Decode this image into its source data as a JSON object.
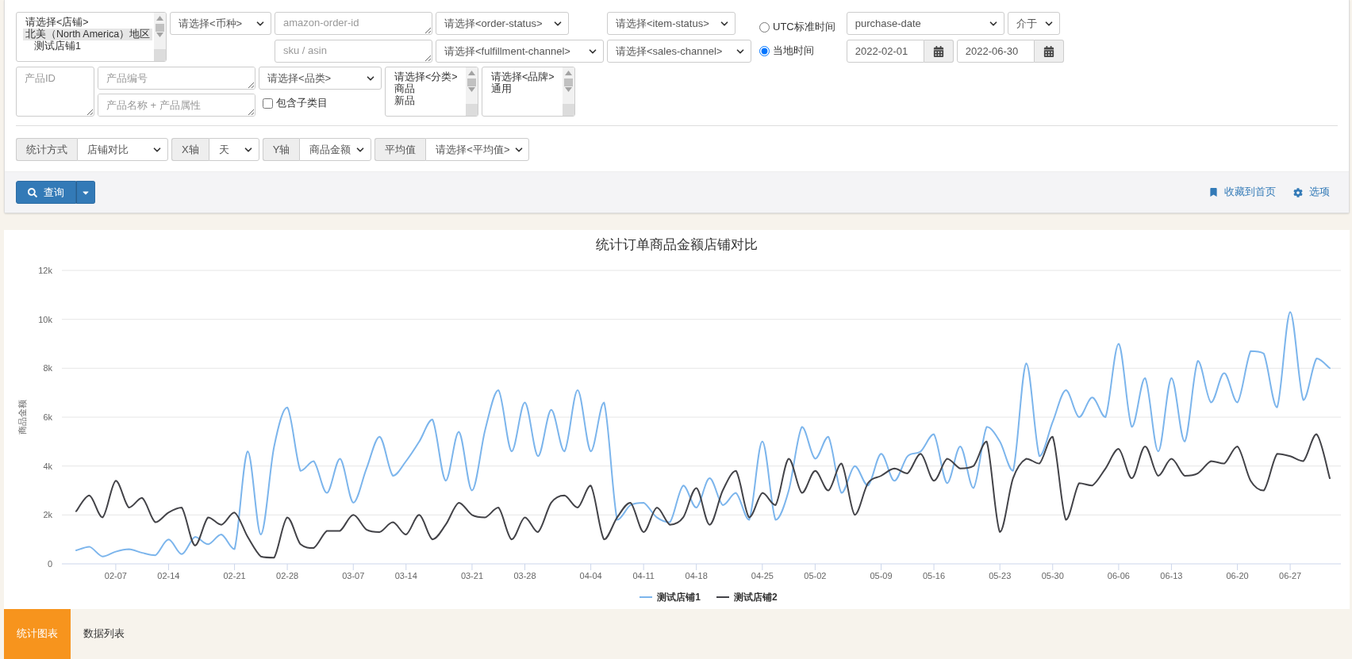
{
  "store_list": {
    "items": [
      {
        "label": "请选择<店铺>",
        "kind": "placeholder",
        "selected": false
      },
      {
        "label": "北美（North America）地区",
        "kind": "group",
        "selected": true
      },
      {
        "label": "测试店铺1",
        "kind": "option",
        "selected": false
      }
    ]
  },
  "currency_select": {
    "value": "请选择<币种>"
  },
  "order_id_field": {
    "placeholder": "amazon-order-id"
  },
  "sku_field": {
    "placeholder": "sku / asin"
  },
  "order_status_select": {
    "value": "请选择<order-status>"
  },
  "fulfillment_channel_select": {
    "value": "请选择<fulfillment-channel>"
  },
  "item_status_select": {
    "value": "请选择<item-status>"
  },
  "sales_channel_select": {
    "value": "请选择<sales-channel>"
  },
  "time_zone": [
    {
      "label": "UTC标准时间",
      "selected": false
    },
    {
      "label": "当地时间",
      "selected": true
    }
  ],
  "date_field_select": {
    "value": "purchase-date"
  },
  "date_operator_select": {
    "value": "介于"
  },
  "date_from": {
    "value": "2022-02-01"
  },
  "date_to": {
    "value": "2022-06-30"
  },
  "product_id_field": {
    "placeholder": "产品ID"
  },
  "product_code_field": {
    "placeholder": "产品编号"
  },
  "product_name_field": {
    "placeholder": "产品名称 + 产品属性"
  },
  "category_select": {
    "value": "请选择<品类>"
  },
  "include_subcategories": {
    "label": "包含子类目",
    "checked": false
  },
  "classification_list": {
    "items": [
      {
        "label": "请选择<分类>",
        "selected": false
      },
      {
        "label": "商品",
        "selected": false
      },
      {
        "label": "新品",
        "selected": false
      }
    ]
  },
  "brand_list": {
    "items": [
      {
        "label": "请选择<品牌>",
        "selected": false
      },
      {
        "label": "通用",
        "selected": false
      }
    ]
  },
  "stat_options": [
    {
      "label": "统计方式",
      "value": "店铺对比"
    },
    {
      "label": "X轴",
      "value": "天"
    },
    {
      "label": "Y轴",
      "value": "商品金额"
    },
    {
      "label": "平均值",
      "value": "请选择<平均值>"
    }
  ],
  "query_button": {
    "label": "查询"
  },
  "actions": [
    {
      "label": "收藏到首页",
      "kind": "bookmark"
    },
    {
      "label": "选项",
      "kind": "settings"
    }
  ],
  "chart": {
    "title": "统计订单商品金额店铺对比",
    "chart_data": {
      "type": "line",
      "grid": true,
      "ylabel": "商品金额",
      "ylim": [
        0,
        12000
      ],
      "yticks": [
        {
          "value": 0,
          "label": "0"
        },
        {
          "value": 2000,
          "label": "2k"
        },
        {
          "value": 4000,
          "label": "4k"
        },
        {
          "value": 6000,
          "label": "6k"
        },
        {
          "value": 8000,
          "label": "8k"
        },
        {
          "value": 10000,
          "label": "10k"
        },
        {
          "value": 12000,
          "label": "12k"
        }
      ],
      "categories": [
        null,
        null,
        null,
        "02-07",
        null,
        null,
        null,
        "02-14",
        null,
        null,
        null,
        null,
        "02-21",
        null,
        null,
        null,
        "02-28",
        null,
        null,
        null,
        null,
        "03-07",
        null,
        null,
        null,
        "03-14",
        null,
        null,
        null,
        null,
        "03-21",
        null,
        null,
        null,
        "03-28",
        null,
        null,
        null,
        null,
        "04-04",
        null,
        null,
        null,
        "04-11",
        null,
        null,
        null,
        "04-18",
        null,
        null,
        null,
        null,
        "04-25",
        null,
        null,
        null,
        "05-02",
        null,
        null,
        null,
        null,
        "05-09",
        null,
        null,
        null,
        "05-16",
        null,
        null,
        null,
        null,
        "05-23",
        null,
        null,
        null,
        "05-30",
        null,
        null,
        null,
        null,
        "06-06",
        null,
        null,
        null,
        "06-13",
        null,
        null,
        null,
        null,
        "06-20",
        null,
        null,
        null,
        "06-27",
        null,
        null,
        null
      ],
      "series": [
        {
          "name": "测试店铺1",
          "color": "#7cb5ec",
          "values": [
            550,
            700,
            300,
            500,
            600,
            450,
            350,
            1000,
            400,
            1100,
            800,
            1200,
            600,
            4600,
            1200,
            4800,
            6400,
            3800,
            4200,
            2900,
            4300,
            2500,
            3900,
            5200,
            3600,
            4200,
            5000,
            5900,
            3400,
            5400,
            3000,
            5500,
            7100,
            4600,
            6600,
            4400,
            6300,
            4600,
            7100,
            4600,
            6600,
            1800,
            2400,
            2500,
            1900,
            1700,
            3200,
            2300,
            3500,
            2400,
            2900,
            1800,
            5000,
            1800,
            3000,
            5600,
            4300,
            5200,
            2900,
            4000,
            3200,
            4500,
            3400,
            4400,
            4600,
            5300,
            3300,
            4800,
            3100,
            5600,
            5000,
            3800,
            8200,
            4400,
            5800,
            7100,
            6000,
            6800,
            6000,
            9000,
            5600,
            7600,
            4600,
            7600,
            5000,
            8300,
            6600,
            7800,
            6600,
            8700,
            8600,
            6400,
            10300,
            6700,
            8400,
            8000
          ]
        },
        {
          "name": "测试店铺2",
          "color": "#434348",
          "values": [
            2150,
            2800,
            1900,
            3400,
            2300,
            2700,
            1700,
            2100,
            2300,
            750,
            1900,
            1600,
            2100,
            1100,
            300,
            250,
            1900,
            800,
            650,
            1350,
            1350,
            2000,
            1400,
            1300,
            1700,
            1200,
            2000,
            1000,
            1600,
            2500,
            2000,
            1900,
            2300,
            1000,
            1900,
            1300,
            2500,
            2800,
            2300,
            3200,
            1000,
            1900,
            2500,
            1300,
            2300,
            1600,
            1900,
            3100,
            1600,
            3000,
            3800,
            1900,
            2900,
            2400,
            4300,
            2900,
            3800,
            3000,
            4100,
            2000,
            3300,
            3600,
            3900,
            3700,
            4500,
            3400,
            4300,
            3900,
            4000,
            5000,
            1300,
            3500,
            4300,
            4100,
            5200,
            1800,
            3300,
            3200,
            3900,
            4700,
            3500,
            4800,
            3600,
            4300,
            3600,
            3700,
            4200,
            4100,
            4800,
            3400,
            3000,
            4500,
            4400,
            4200,
            5300,
            3500
          ]
        }
      ]
    }
  },
  "tabs": [
    {
      "label": "统计图表",
      "selected": true
    },
    {
      "label": "数据列表",
      "selected": false
    }
  ]
}
